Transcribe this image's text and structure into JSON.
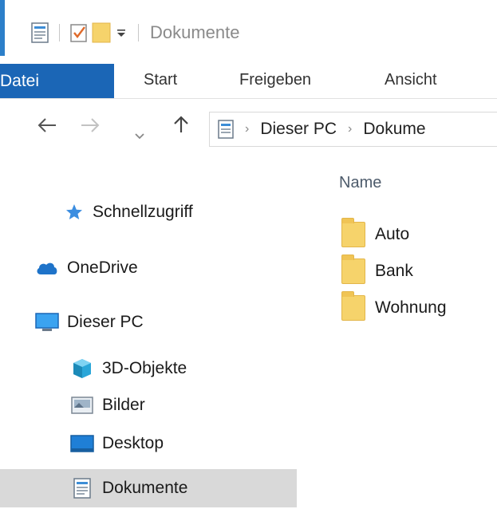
{
  "window": {
    "title": "Dokumente",
    "accent_color": "#2c7fc9"
  },
  "quick_access_toolbar": {
    "icons": [
      "document-properties-icon",
      "checkmark-document-icon",
      "new-folder-icon",
      "customize-dropdown-icon"
    ]
  },
  "ribbon": {
    "tabs": [
      {
        "label": "Datei",
        "active": true
      },
      {
        "label": "Start"
      },
      {
        "label": "Freigeben"
      },
      {
        "label": "Ansicht"
      }
    ],
    "file_tab_color": "#1b66b6"
  },
  "address_bar": {
    "breadcrumbs": [
      "Dieser PC",
      "Dokume"
    ]
  },
  "navigation_pane": {
    "items": [
      {
        "label": "Schnellzugriff",
        "icon": "star-icon"
      },
      {
        "label": "OneDrive",
        "icon": "cloud-icon"
      },
      {
        "label": "Dieser PC",
        "icon": "monitor-icon"
      },
      {
        "label": "3D-Objekte",
        "icon": "cube-icon"
      },
      {
        "label": "Bilder",
        "icon": "pictures-icon"
      },
      {
        "label": "Desktop",
        "icon": "desktop-icon"
      },
      {
        "label": "Dokumente",
        "icon": "document-icon",
        "selected": true
      }
    ]
  },
  "content": {
    "column_header": "Name",
    "files": [
      {
        "name": "Auto",
        "icon": "folder-icon"
      },
      {
        "name": "Bank",
        "icon": "folder-icon"
      },
      {
        "name": "Wohnung",
        "icon": "folder-icon"
      }
    ]
  }
}
